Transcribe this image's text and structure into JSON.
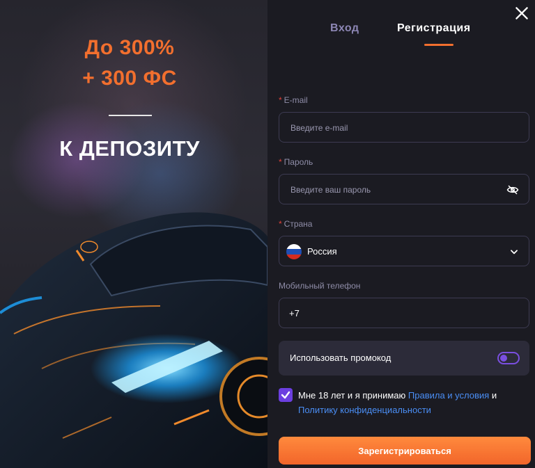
{
  "promo": {
    "line1": "До 300%",
    "line2": "+ 300 ФС",
    "subtitle": "К ДЕПОЗИТУ"
  },
  "tabs": {
    "login": "Вход",
    "register": "Регистрация",
    "active": "register"
  },
  "form": {
    "email": {
      "label": "E-mail",
      "required": true,
      "placeholder": "Введите e-mail"
    },
    "password": {
      "label": "Пароль",
      "required": true,
      "placeholder": "Введите ваш пароль"
    },
    "country": {
      "label": "Страна",
      "required": true,
      "value": "Россия",
      "flag": "ru-flag-icon"
    },
    "phone": {
      "label": "Мобильный телефон",
      "value": "+7"
    },
    "promocode": {
      "label": "Использовать промокод",
      "enabled": false
    },
    "terms": {
      "checked": true,
      "text_before": "Мне 18 лет и я принимаю ",
      "link1": "Правила и условия",
      "middle": " и ",
      "link2": "Политику конфиденциальности"
    },
    "submit_label": "Зарегистрироваться"
  },
  "colors": {
    "accent": "#f26f2e",
    "purple": "#6c3fe0",
    "link": "#4a8ef5",
    "background": "#1b1b22"
  }
}
